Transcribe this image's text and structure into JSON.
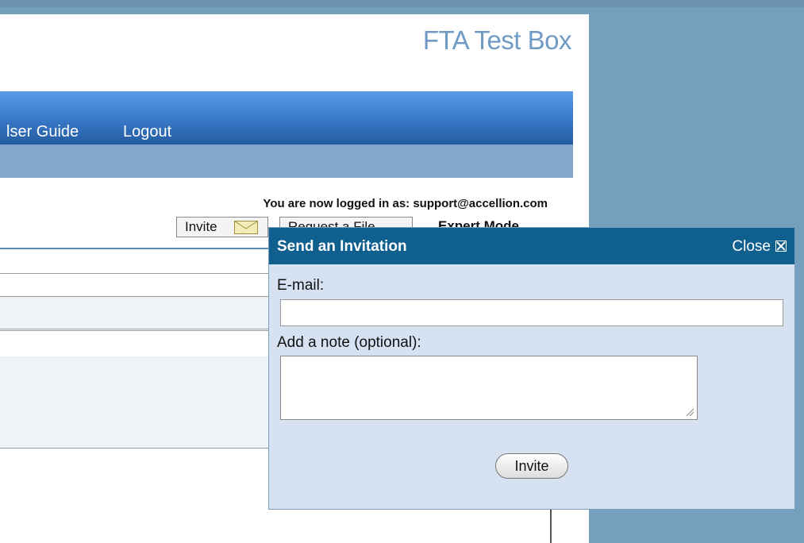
{
  "site": {
    "brand": "FTA Test Box"
  },
  "nav": {
    "user_guide": "lser Guide",
    "logout": "Logout"
  },
  "session": {
    "logged_in_text": "You are now logged in as: support@accellion.com"
  },
  "toolbar": {
    "invite_label": "Invite",
    "request_label": "Request a File",
    "expert_mode_label": "Expert Mode"
  },
  "dialog": {
    "title": "Send an Invitation",
    "close_label": "Close",
    "email_label": "E-mail:",
    "email_value": "",
    "note_label": "Add a note (optional):",
    "note_value": "",
    "submit_label": "Invite"
  },
  "icons": {
    "invite": "envelope-icon",
    "request": "document-icon",
    "close": "close-box-icon",
    "resize": "resize-grip-icon"
  },
  "colors": {
    "nav_bar": "#3c7dce",
    "dialog_header": "#0f5f8f",
    "dialog_body": "#d6e2f1",
    "backdrop": "#759fbd",
    "brand": "#6f9bc4"
  }
}
